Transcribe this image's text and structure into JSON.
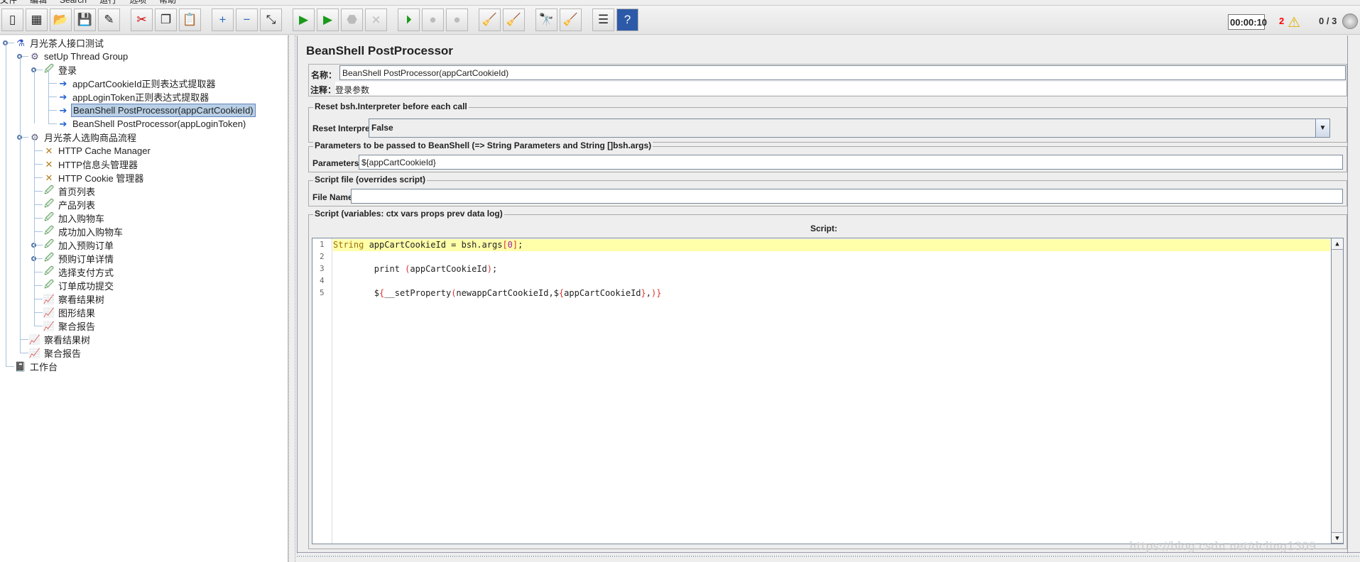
{
  "menu": [
    "文件",
    "编辑",
    "Search",
    "运行",
    "选项",
    "帮助"
  ],
  "toolbar": {
    "buttons": [
      {
        "name": "new-icon",
        "glyph": "▯"
      },
      {
        "name": "templates-icon",
        "glyph": "▦"
      },
      {
        "name": "open-icon",
        "glyph": "📂"
      },
      {
        "name": "save-icon",
        "glyph": "💾"
      },
      {
        "name": "save-as-icon",
        "glyph": "✎"
      },
      {
        "name": "cut-icon",
        "glyph": "✂"
      },
      {
        "name": "copy-icon",
        "glyph": "❐"
      },
      {
        "name": "paste-icon",
        "glyph": "📋"
      },
      {
        "name": "expand-icon",
        "glyph": "+"
      },
      {
        "name": "collapse-icon",
        "glyph": "−"
      },
      {
        "name": "toggle-icon",
        "glyph": "⤡"
      },
      {
        "name": "start-icon",
        "glyph": "▶"
      },
      {
        "name": "start-no-pause-icon",
        "glyph": "▶"
      },
      {
        "name": "stop-icon",
        "glyph": "⬣"
      },
      {
        "name": "shutdown-icon",
        "glyph": "⨯"
      },
      {
        "name": "remote-start-icon",
        "glyph": "⏵"
      },
      {
        "name": "remote-stop-icon",
        "glyph": "●"
      },
      {
        "name": "remote-shutdown-icon",
        "glyph": "●"
      },
      {
        "name": "clear-icon",
        "glyph": "🧹"
      },
      {
        "name": "clear-all-icon",
        "glyph": "🧹"
      },
      {
        "name": "search-icon",
        "glyph": "🔭"
      },
      {
        "name": "reset-search-icon",
        "glyph": "🧹"
      },
      {
        "name": "function-helper-icon",
        "glyph": "☰"
      },
      {
        "name": "help-icon",
        "glyph": "?"
      }
    ]
  },
  "status": {
    "timer": "00:00:10",
    "error_count": "2",
    "threads": "0 / 3"
  },
  "tree": [
    {
      "label": "月光茶人接口测试",
      "level": 0,
      "icon": "test-plan-icon",
      "glyph": "⚗"
    },
    {
      "label": "setUp Thread Group",
      "level": 1,
      "icon": "thread-group-icon",
      "glyph": "⚙"
    },
    {
      "label": "登录",
      "level": 2,
      "icon": "sampler-icon",
      "glyph": "🖉"
    },
    {
      "label": "appCartCookieId正则表达式提取器",
      "level": 3,
      "icon": "post-processor-icon",
      "glyph": "➔"
    },
    {
      "label": "appLoginToken正则表达式提取器",
      "level": 3,
      "icon": "post-processor-icon",
      "glyph": "➔"
    },
    {
      "label": "BeanShell PostProcessor(appCartCookieId)",
      "level": 3,
      "icon": "post-processor-icon",
      "glyph": "➔",
      "selected": true
    },
    {
      "label": "BeanShell PostProcessor(appLoginToken)",
      "level": 3,
      "icon": "post-processor-icon",
      "glyph": "➔"
    },
    {
      "label": "月光茶人选购商品流程",
      "level": 1,
      "icon": "thread-group-icon",
      "glyph": "⚙"
    },
    {
      "label": "HTTP Cache Manager",
      "level": 2,
      "icon": "config-element-icon",
      "glyph": "✕"
    },
    {
      "label": "HTTP信息头管理器",
      "level": 2,
      "icon": "config-element-icon",
      "glyph": "✕"
    },
    {
      "label": "HTTP Cookie 管理器",
      "level": 2,
      "icon": "config-element-icon",
      "glyph": "✕"
    },
    {
      "label": "首页列表",
      "level": 2,
      "icon": "sampler-icon",
      "glyph": "🖉"
    },
    {
      "label": "产品列表",
      "level": 2,
      "icon": "sampler-icon",
      "glyph": "🖉"
    },
    {
      "label": "加入购物车",
      "level": 2,
      "icon": "sampler-icon",
      "glyph": "🖉"
    },
    {
      "label": "成功加入购物车",
      "level": 2,
      "icon": "sampler-icon",
      "glyph": "🖉"
    },
    {
      "label": "加入预购订单",
      "level": 2,
      "icon": "sampler-icon",
      "glyph": "🖉",
      "knob": true
    },
    {
      "label": "预购订单详情",
      "level": 2,
      "icon": "sampler-icon",
      "glyph": "🖉",
      "knob": true
    },
    {
      "label": "选择支付方式",
      "level": 2,
      "icon": "sampler-icon",
      "glyph": "🖉"
    },
    {
      "label": "订单成功提交",
      "level": 2,
      "icon": "sampler-icon",
      "glyph": "🖉"
    },
    {
      "label": "察看结果树",
      "level": 2,
      "icon": "listener-icon",
      "glyph": "📈"
    },
    {
      "label": "图形结果",
      "level": 2,
      "icon": "listener-icon",
      "glyph": "📈"
    },
    {
      "label": "聚合报告",
      "level": 2,
      "icon": "listener-icon",
      "glyph": "📈"
    },
    {
      "label": "察看结果树",
      "level": 1,
      "icon": "listener-icon",
      "glyph": "📈"
    },
    {
      "label": "聚合报告",
      "level": 1,
      "icon": "listener-icon",
      "glyph": "📈"
    },
    {
      "label": "工作台",
      "level": 0,
      "icon": "workbench-icon",
      "glyph": "📓"
    }
  ],
  "panel": {
    "title": "BeanShell PostProcessor",
    "name_label": "名称：",
    "name_value": "BeanShell PostProcessor(appCartCookieId)",
    "comment_label": "注释：",
    "comment_value": "登录参数",
    "reset_group": "Reset bsh.Interpreter before each call",
    "reset_label": "Reset Interpreter:",
    "reset_value": "False",
    "params_group": "Parameters to be passed to BeanShell (=> String Parameters and String []bsh.args)",
    "params_label": "Parameters:",
    "params_value": "${appCartCookieId}",
    "file_group": "Script file (overrides script)",
    "file_label": "File Name:",
    "file_value": "",
    "script_group": "Script (variables: ctx vars props prev data log)",
    "script_label": "Script:",
    "script_lines": [
      "String appCartCookieId = bsh.args[0];",
      "",
      "        print (appCartCookieId);",
      "",
      "        ${__setProperty(newappCartCookieId,${appCartCookieId},)}"
    ]
  },
  "watermark": "https://blog.csdn.net/dcling1309"
}
